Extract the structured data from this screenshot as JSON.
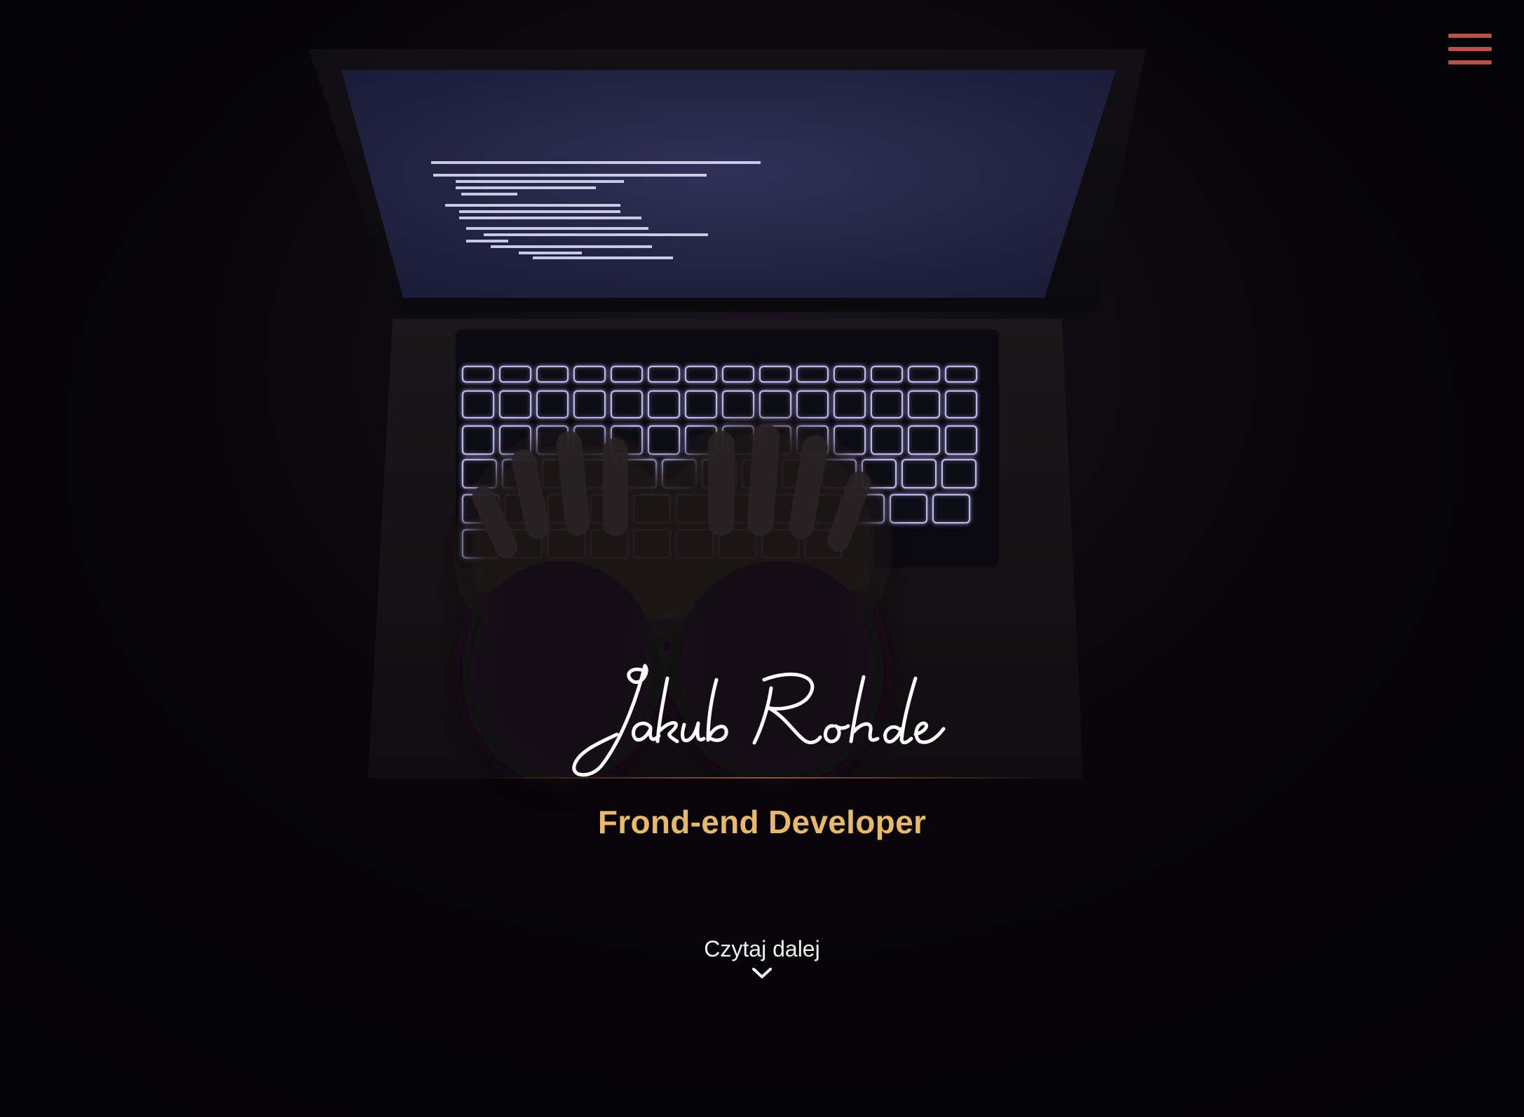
{
  "hero": {
    "name": "Jakub Rohde",
    "role": "Frond-end Developer",
    "cta_label": "Czytaj dalej",
    "background_image": "laptop-keyboard-at-night-photo"
  },
  "nav": {
    "menu_icon": "hamburger-menu-icon"
  },
  "colors": {
    "background": "#07050a",
    "accent_role": "#e8b96a",
    "menu_icon": "#b5524a",
    "divider": "#b45a32",
    "signature": "#ffffff",
    "cta_text": "#f2f2f2"
  }
}
